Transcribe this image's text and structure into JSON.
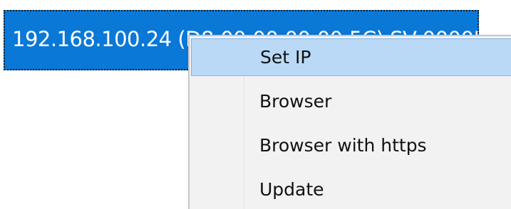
{
  "list": {
    "selected_row_text": "192.168.100.24 (D8:00:00:00:00:5C)    SV-00005C"
  },
  "context_menu": {
    "items": [
      {
        "label": "Set IP",
        "highlighted": true
      },
      {
        "label": "Browser",
        "highlighted": false
      },
      {
        "label": "Browser with https",
        "highlighted": false
      },
      {
        "label": "Update",
        "highlighted": false
      }
    ]
  },
  "colors": {
    "selection": "#0a78d7",
    "menu_background": "#f2f2f2",
    "menu_highlight": "#b9d9f7"
  }
}
